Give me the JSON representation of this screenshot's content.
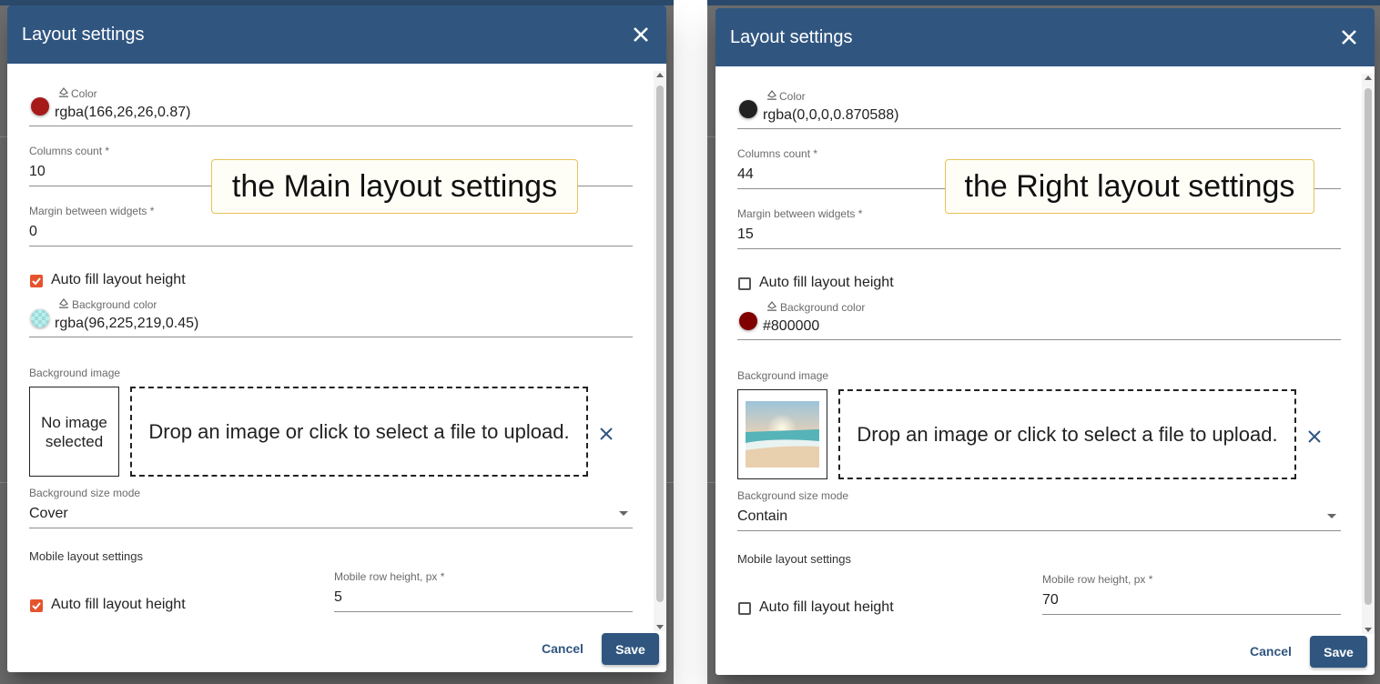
{
  "panels": [
    {
      "title": "Layout settings",
      "color": {
        "label": "Color",
        "value": "rgba(166,26,26,0.87)",
        "swatch": "#a61a1a"
      },
      "columns_count": {
        "label": "Columns count *",
        "value": "10"
      },
      "margin": {
        "label": "Margin between widgets *",
        "value": "0"
      },
      "auto_fill": {
        "label": "Auto fill layout height",
        "checked": true
      },
      "bg_color": {
        "label": "Background color",
        "value": "rgba(96,225,219,0.45)",
        "swatch": "rgba(96,225,219,0.45)"
      },
      "bg_image": {
        "label": "Background image",
        "thumb_text": "No image selected",
        "has_image": false,
        "dropzone": "Drop an image or click to select a file to upload."
      },
      "size_mode": {
        "label": "Background size mode",
        "value": "Cover"
      },
      "mobile": {
        "title": "Mobile layout settings",
        "auto_fill_label": "Auto fill layout height",
        "auto_fill_checked": true,
        "row_height_label": "Mobile row height, px *",
        "row_height_value": "5"
      },
      "cancel": "Cancel",
      "save": "Save",
      "callout": "the Main layout settings"
    },
    {
      "title": "Layout settings",
      "color": {
        "label": "Color",
        "value": "rgba(0,0,0,0.870588)",
        "swatch": "#212121"
      },
      "columns_count": {
        "label": "Columns count *",
        "value": "44"
      },
      "margin": {
        "label": "Margin between widgets *",
        "value": "15"
      },
      "auto_fill": {
        "label": "Auto fill layout height",
        "checked": false
      },
      "bg_color": {
        "label": "Background color",
        "value": "#800000",
        "swatch": "#800000"
      },
      "bg_image": {
        "label": "Background image",
        "thumb_text": "",
        "has_image": true,
        "dropzone": "Drop an image or click to select a file to upload."
      },
      "size_mode": {
        "label": "Background size mode",
        "value": "Contain"
      },
      "mobile": {
        "title": "Mobile layout settings",
        "auto_fill_label": "Auto fill layout height",
        "auto_fill_checked": false,
        "row_height_label": "Mobile row height, px *",
        "row_height_value": "70"
      },
      "cancel": "Cancel",
      "save": "Save",
      "callout": "the Right layout settings"
    }
  ],
  "colors": {
    "header": "#305680",
    "checkbox_on": "#e5532d"
  },
  "icons": {
    "close": "close-icon",
    "pencil": "format-color-fill-icon",
    "remove": "remove-image-icon",
    "dropdown": "dropdown-arrow-icon"
  }
}
